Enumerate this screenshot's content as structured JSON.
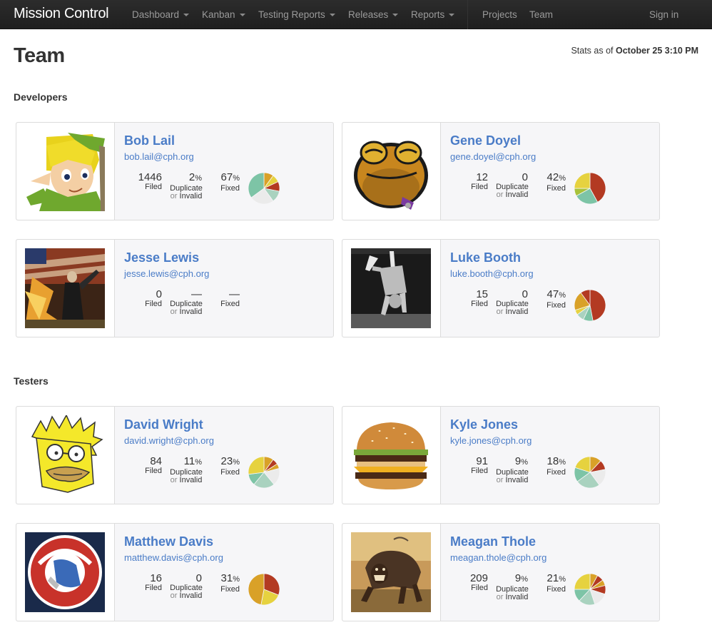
{
  "app": {
    "title": "Mission Control"
  },
  "nav": {
    "items": [
      {
        "label": "Dashboard",
        "dropdown": true
      },
      {
        "label": "Kanban",
        "dropdown": true
      },
      {
        "label": "Testing Reports",
        "dropdown": true
      },
      {
        "label": "Releases",
        "dropdown": true
      },
      {
        "label": "Reports",
        "dropdown": true
      },
      {
        "label": "Projects",
        "dropdown": false
      },
      {
        "label": "Team",
        "dropdown": false
      }
    ],
    "signin_label": "Sign in"
  },
  "page": {
    "title": "Team",
    "stats_prefix": "Stats as of",
    "stats_date": "October 25 3:10 PM"
  },
  "labels": {
    "filed": "Filed",
    "duplicate": "Duplicate",
    "or": "or",
    "invalid": "Invalid",
    "fixed": "Fixed",
    "pct": "%"
  },
  "colors": {
    "red": "#b33a22",
    "gold": "#d9a128",
    "yellow": "#e6d23f",
    "teal": "#7dc4a6",
    "mint": "#a9d2bf",
    "gray": "#ebebeb",
    "green": "#a8c23a",
    "link": "#4a7cc7"
  },
  "sections": [
    {
      "title": "Developers",
      "members": [
        {
          "name": "Bob Lail",
          "email": "bob.lail@cph.org",
          "avatar": "link-icon",
          "filed": "1446",
          "duplicate": "2",
          "duplicate_pct": true,
          "fixed": "67",
          "fixed_pct": true,
          "pie": [
            {
              "value": 10,
              "color": "gold"
            },
            {
              "value": 8,
              "color": "yellow"
            },
            {
              "value": 10,
              "color": "red"
            },
            {
              "value": 12,
              "color": "mint"
            },
            {
              "value": 25,
              "color": "gray"
            },
            {
              "value": 35,
              "color": "teal"
            }
          ]
        },
        {
          "name": "Gene Doyel",
          "email": "gene.doyel@cph.org",
          "avatar": "toad-icon",
          "filed": "12",
          "duplicate": "0",
          "duplicate_pct": false,
          "fixed": "42",
          "fixed_pct": true,
          "pie": [
            {
              "value": 42,
              "color": "red"
            },
            {
              "value": 25,
              "color": "teal"
            },
            {
              "value": 8,
              "color": "green"
            },
            {
              "value": 25,
              "color": "yellow"
            }
          ]
        },
        {
          "name": "Jesse Lewis",
          "email": "jesse.lewis@cph.org",
          "avatar": "warrior-icon",
          "filed": "0",
          "duplicate": "—",
          "duplicate_pct": false,
          "fixed": "—",
          "fixed_pct": false,
          "pie": []
        },
        {
          "name": "Luke Booth",
          "email": "luke.booth@cph.org",
          "avatar": "handstand-icon",
          "filed": "15",
          "duplicate": "0",
          "duplicate_pct": false,
          "fixed": "47",
          "fixed_pct": true,
          "pie": [
            {
              "value": 47,
              "color": "red"
            },
            {
              "value": 10,
              "color": "teal"
            },
            {
              "value": 8,
              "color": "mint"
            },
            {
              "value": 5,
              "color": "yellow"
            },
            {
              "value": 20,
              "color": "gold"
            },
            {
              "value": 10,
              "color": "red"
            }
          ]
        }
      ]
    },
    {
      "title": "Testers",
      "members": [
        {
          "name": "David Wright",
          "email": "david.wright@cph.org",
          "avatar": "cartoon-icon",
          "filed": "84",
          "duplicate": "11",
          "duplicate_pct": true,
          "fixed": "23",
          "fixed_pct": true,
          "pie": [
            {
              "value": 10,
              "color": "gold"
            },
            {
              "value": 6,
              "color": "red"
            },
            {
              "value": 5,
              "color": "gold"
            },
            {
              "value": 18,
              "color": "gray"
            },
            {
              "value": 22,
              "color": "mint"
            },
            {
              "value": 12,
              "color": "teal"
            },
            {
              "value": 27,
              "color": "yellow"
            }
          ]
        },
        {
          "name": "Kyle Jones",
          "email": "kyle.jones@cph.org",
          "avatar": "burger-icon",
          "filed": "91",
          "duplicate": "9",
          "duplicate_pct": true,
          "fixed": "18",
          "fixed_pct": true,
          "pie": [
            {
              "value": 12,
              "color": "gold"
            },
            {
              "value": 10,
              "color": "red"
            },
            {
              "value": 18,
              "color": "gray"
            },
            {
              "value": 25,
              "color": "mint"
            },
            {
              "value": 15,
              "color": "teal"
            },
            {
              "value": 20,
              "color": "yellow"
            }
          ]
        },
        {
          "name": "Matthew Davis",
          "email": "matthew.davis@cph.org",
          "avatar": "arm-buster-logo",
          "filed": "16",
          "duplicate": "0",
          "duplicate_pct": false,
          "fixed": "31",
          "fixed_pct": true,
          "pie": [
            {
              "value": 31,
              "color": "red"
            },
            {
              "value": 22,
              "color": "yellow"
            },
            {
              "value": 47,
              "color": "gold"
            }
          ]
        },
        {
          "name": "Meagan Thole",
          "email": "meagan.thole@cph.org",
          "avatar": "creature-icon",
          "filed": "209",
          "duplicate": "9",
          "duplicate_pct": true,
          "fixed": "21",
          "fixed_pct": true,
          "pie": [
            {
              "value": 8,
              "color": "gold"
            },
            {
              "value": 7,
              "color": "red"
            },
            {
              "value": 6,
              "color": "gold"
            },
            {
              "value": 9,
              "color": "red"
            },
            {
              "value": 15,
              "color": "gray"
            },
            {
              "value": 17,
              "color": "mint"
            },
            {
              "value": 13,
              "color": "teal"
            },
            {
              "value": 25,
              "color": "yellow"
            }
          ]
        }
      ]
    }
  ]
}
